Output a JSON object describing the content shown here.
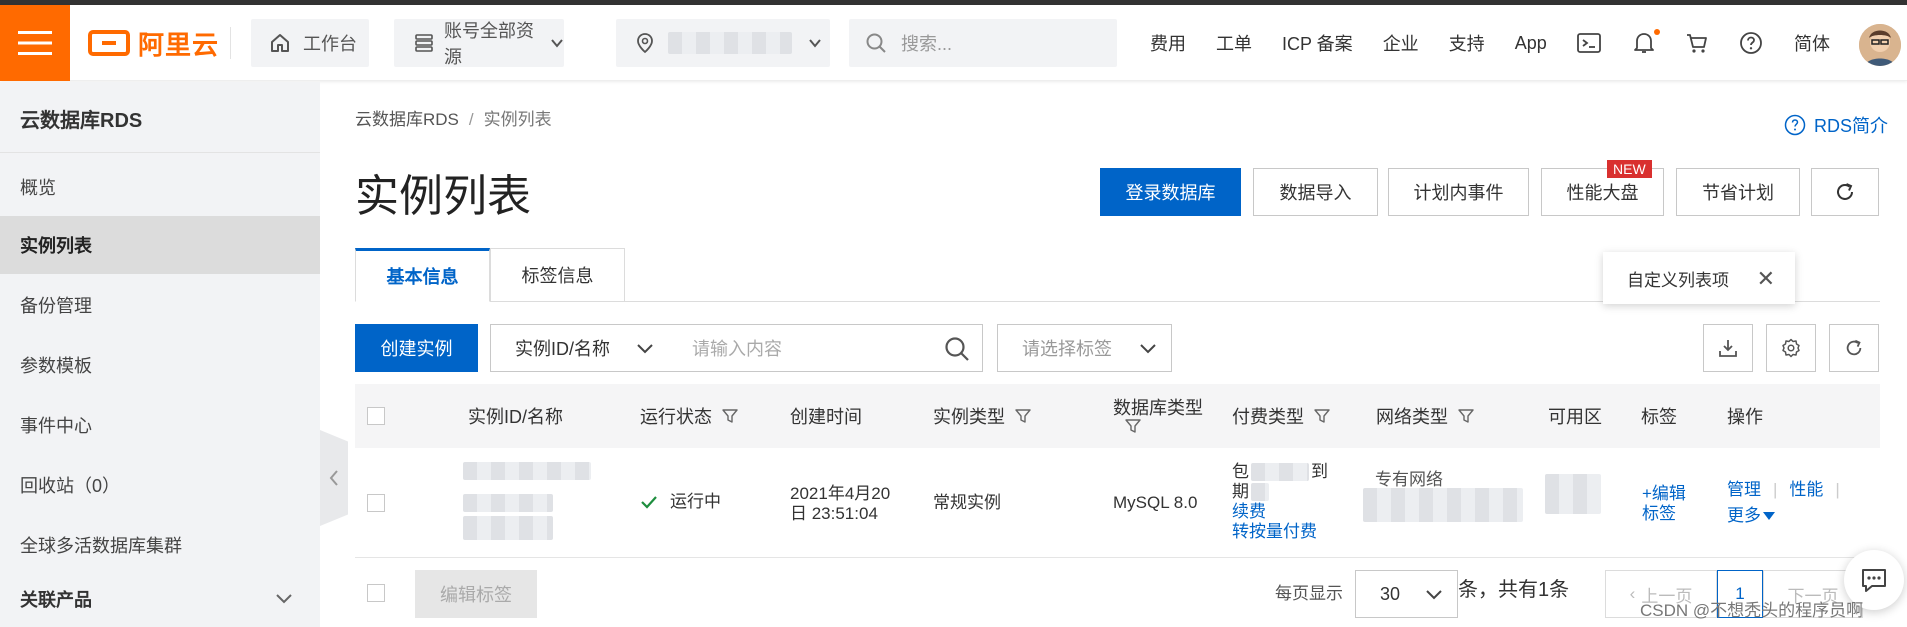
{
  "topbar": {
    "logo_text": "阿里云",
    "workbench": "工作台",
    "resources": "账号全部资源",
    "search_placeholder": "搜索...",
    "nav": [
      "费用",
      "工单",
      "ICP 备案",
      "企业",
      "支持",
      "App"
    ],
    "lang": "简体",
    "accent": "#ff6a00"
  },
  "sidebar": {
    "title": "云数据库RDS",
    "items": [
      "概览",
      "实例列表",
      "备份管理",
      "参数模板",
      "事件中心",
      "回收站（0）",
      "全球多活数据库集群"
    ],
    "active_index": 1,
    "section": "关联产品"
  },
  "breadcrumb": {
    "root": "云数据库RDS",
    "sep": "/",
    "current": "实例列表"
  },
  "header": {
    "title": "实例列表",
    "intro_link": "RDS简介",
    "buttons": [
      "登录数据库",
      "数据导入",
      "计划内事件",
      "性能大盘",
      "节省计划"
    ],
    "new_badge": "NEW"
  },
  "tabs": [
    "基本信息",
    "标签信息"
  ],
  "tooltip": "自定义列表项",
  "toolbar": {
    "create": "创建实例",
    "filter_select": "实例ID/名称",
    "search_placeholder": "请输入内容",
    "tag_placeholder": "请选择标签"
  },
  "table": {
    "columns": [
      "实例ID/名称",
      "运行状态",
      "创建时间",
      "实例类型",
      "数据库类型",
      "付费类型",
      "网络类型",
      "可用区",
      "标签",
      "操作"
    ],
    "row": {
      "status": "运行中",
      "created": "2021年4月20日 23:51:04",
      "instance_type": "常规实例",
      "db_type": "MySQL 8.0",
      "pay_line1": "包",
      "pay_line1b": "到",
      "pay_line2": "期",
      "renew": "续费",
      "convert": "转按量付费",
      "network": "专有网络",
      "tag_edit": "+编辑标签",
      "ops_manage": "管理",
      "ops_perf": "性能",
      "ops_more": "更多"
    }
  },
  "footer": {
    "edit_tags": "编辑标签",
    "per_page_label": "每页显示",
    "per_page": "30",
    "total": "条，共有1条",
    "prev": "上一页",
    "page": "1",
    "next": "下一页"
  },
  "watermark": "CSDN @不想秃头的程序员啊",
  "colors": {
    "primary": "#0064c8",
    "orange": "#ff6a00",
    "success": "#1e8e3e",
    "badge": "#d9302f"
  }
}
